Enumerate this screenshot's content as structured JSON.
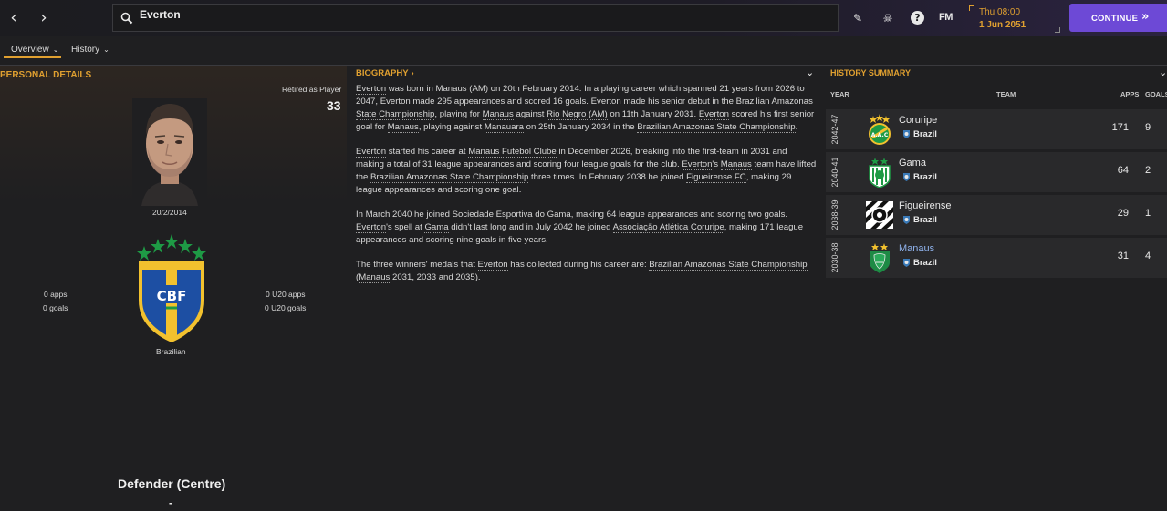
{
  "topbar": {
    "search_value": "Everton",
    "date_day": "Thu 08:00",
    "date_full": "1 Jun 2051",
    "fm_label": "FM",
    "continue_label": "CONTINUE"
  },
  "tabs": [
    {
      "label": "Overview"
    },
    {
      "label": "History"
    }
  ],
  "personal": {
    "title": "PERSONAL DETAILS",
    "retired_label": "Retired as Player",
    "age": "33",
    "dob": "20/2/2014",
    "apps": "0 apps",
    "goals": "0 goals",
    "u20_apps": "0 U20 apps",
    "u20_goals": "0 U20 goals",
    "nationality": "Brazilian",
    "flag_text": "CBF",
    "position": "Defender (Centre)",
    "position_sub": "-"
  },
  "biography": {
    "title": "BIOGRAPHY",
    "p1": [
      {
        "t": "Everton",
        "l": true
      },
      {
        "t": " was born in Manaus (AM) on 20th February 2014. In a playing career which spanned 21 years from 2026 to 2047, "
      },
      {
        "t": "Everton",
        "l": true
      },
      {
        "t": " made 295 appearances and scored 16 goals. "
      },
      {
        "t": "Everton",
        "l": true
      },
      {
        "t": " made his senior debut in the "
      },
      {
        "t": "Brazilian Amazonas State Championship",
        "l": true
      },
      {
        "t": ", playing for "
      },
      {
        "t": "Manaus",
        "l": true
      },
      {
        "t": " against "
      },
      {
        "t": "Rio Negro (AM)",
        "l": true
      },
      {
        "t": " on 11th January 2031. "
      },
      {
        "t": "Everton",
        "l": true
      },
      {
        "t": " scored his first senior goal for "
      },
      {
        "t": "Manaus",
        "l": true
      },
      {
        "t": ", playing against "
      },
      {
        "t": "Manauara",
        "l": true
      },
      {
        "t": " on 25th January 2034 in the "
      },
      {
        "t": "Brazilian Amazonas State Championship",
        "l": true
      },
      {
        "t": "."
      }
    ],
    "p2": [
      {
        "t": "Everton",
        "l": true
      },
      {
        "t": " started his career at "
      },
      {
        "t": "Manaus Futebol Clube",
        "l": true
      },
      {
        "t": " in December 2026, breaking into the first-team in 2031 and making a total of 31 league appearances and scoring four league goals for the club. "
      },
      {
        "t": "Everton",
        "l": true
      },
      {
        "t": "'s "
      },
      {
        "t": "Manaus",
        "l": true
      },
      {
        "t": " team have lifted the "
      },
      {
        "t": "Brazilian Amazonas State Championship",
        "l": true
      },
      {
        "t": " three times. In February 2038 he joined "
      },
      {
        "t": "Figueirense FC",
        "l": true
      },
      {
        "t": ", making 29 league appearances and scoring one goal."
      }
    ],
    "p3": [
      {
        "t": "In March 2040 he joined "
      },
      {
        "t": "Sociedade Esportiva do Gama",
        "l": true
      },
      {
        "t": ", making 64 league appearances and scoring two goals. "
      },
      {
        "t": "Everton",
        "l": true
      },
      {
        "t": "'s spell at "
      },
      {
        "t": "Gama",
        "l": true
      },
      {
        "t": " didn't last long and in July 2042 he joined "
      },
      {
        "t": "Associação Atlética Coruripe",
        "l": true
      },
      {
        "t": ", making 171 league appearances and scoring nine goals in five years."
      }
    ],
    "p4": [
      {
        "t": "The three winners' medals that "
      },
      {
        "t": "Everton",
        "l": true
      },
      {
        "t": " has collected during his career are: "
      },
      {
        "t": "Brazilian Amazonas State Championship",
        "l": true
      },
      {
        "t": " ("
      },
      {
        "t": "Manaus",
        "l": true
      },
      {
        "t": " 2031, 2033 and 2035)."
      }
    ]
  },
  "history": {
    "title": "HISTORY SUMMARY",
    "col_year": "YEAR",
    "col_team": "TEAM",
    "col_apps": "APPS",
    "col_goals": "GOALS",
    "rows": [
      {
        "year": "2042-47",
        "team": "Coruripe",
        "nation": "Brazil",
        "apps": "171",
        "goals": "9",
        "link": false
      },
      {
        "year": "2040-41",
        "team": "Gama",
        "nation": "Brazil",
        "apps": "64",
        "goals": "2",
        "link": false
      },
      {
        "year": "2038-39",
        "team": "Figueirense",
        "nation": "Brazil",
        "apps": "29",
        "goals": "1",
        "link": false
      },
      {
        "year": "2030-38",
        "team": "Manaus",
        "nation": "Brazil",
        "apps": "31",
        "goals": "4",
        "link": true
      }
    ]
  },
  "colors": {
    "accent": "#e0a030",
    "continue": "#6d49d6",
    "link": "#8fb2ec",
    "background": "#1f1f21"
  }
}
